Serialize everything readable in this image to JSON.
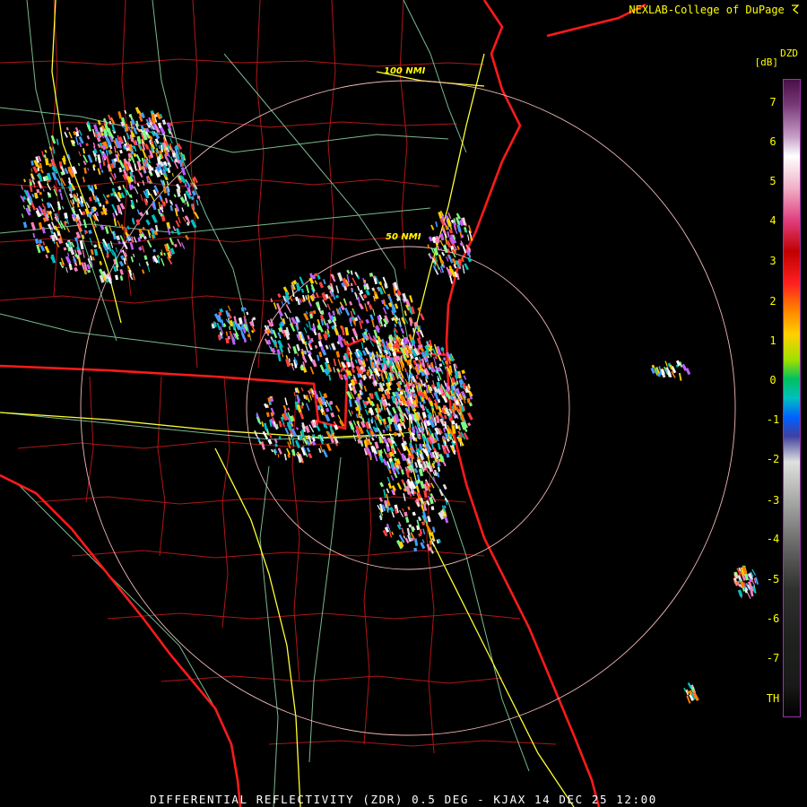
{
  "credit": "NEXLAB-College of DuPage",
  "product_title": "DIFFERENTIAL REFLECTIVITY (ZDR) 0.5 DEG - KJAX 14 DEC 25 12:00",
  "legend": {
    "product_code": "DZD",
    "unit": "[dB]",
    "ticks": [
      "7",
      "6",
      "5",
      "4",
      "3",
      "2",
      "1",
      "0",
      "-1",
      "-2",
      "-3",
      "-4",
      "-5",
      "-6",
      "-7",
      "TH"
    ]
  },
  "range_rings": [
    "50 NMI",
    "100 NMI"
  ],
  "colors": {
    "state_border": "#ff1a1a",
    "county_border": "#b01616",
    "highway": "#ffff33",
    "road": "#8fd9a8",
    "range_ring": "#f0b8b8",
    "label": "#ffff00"
  }
}
